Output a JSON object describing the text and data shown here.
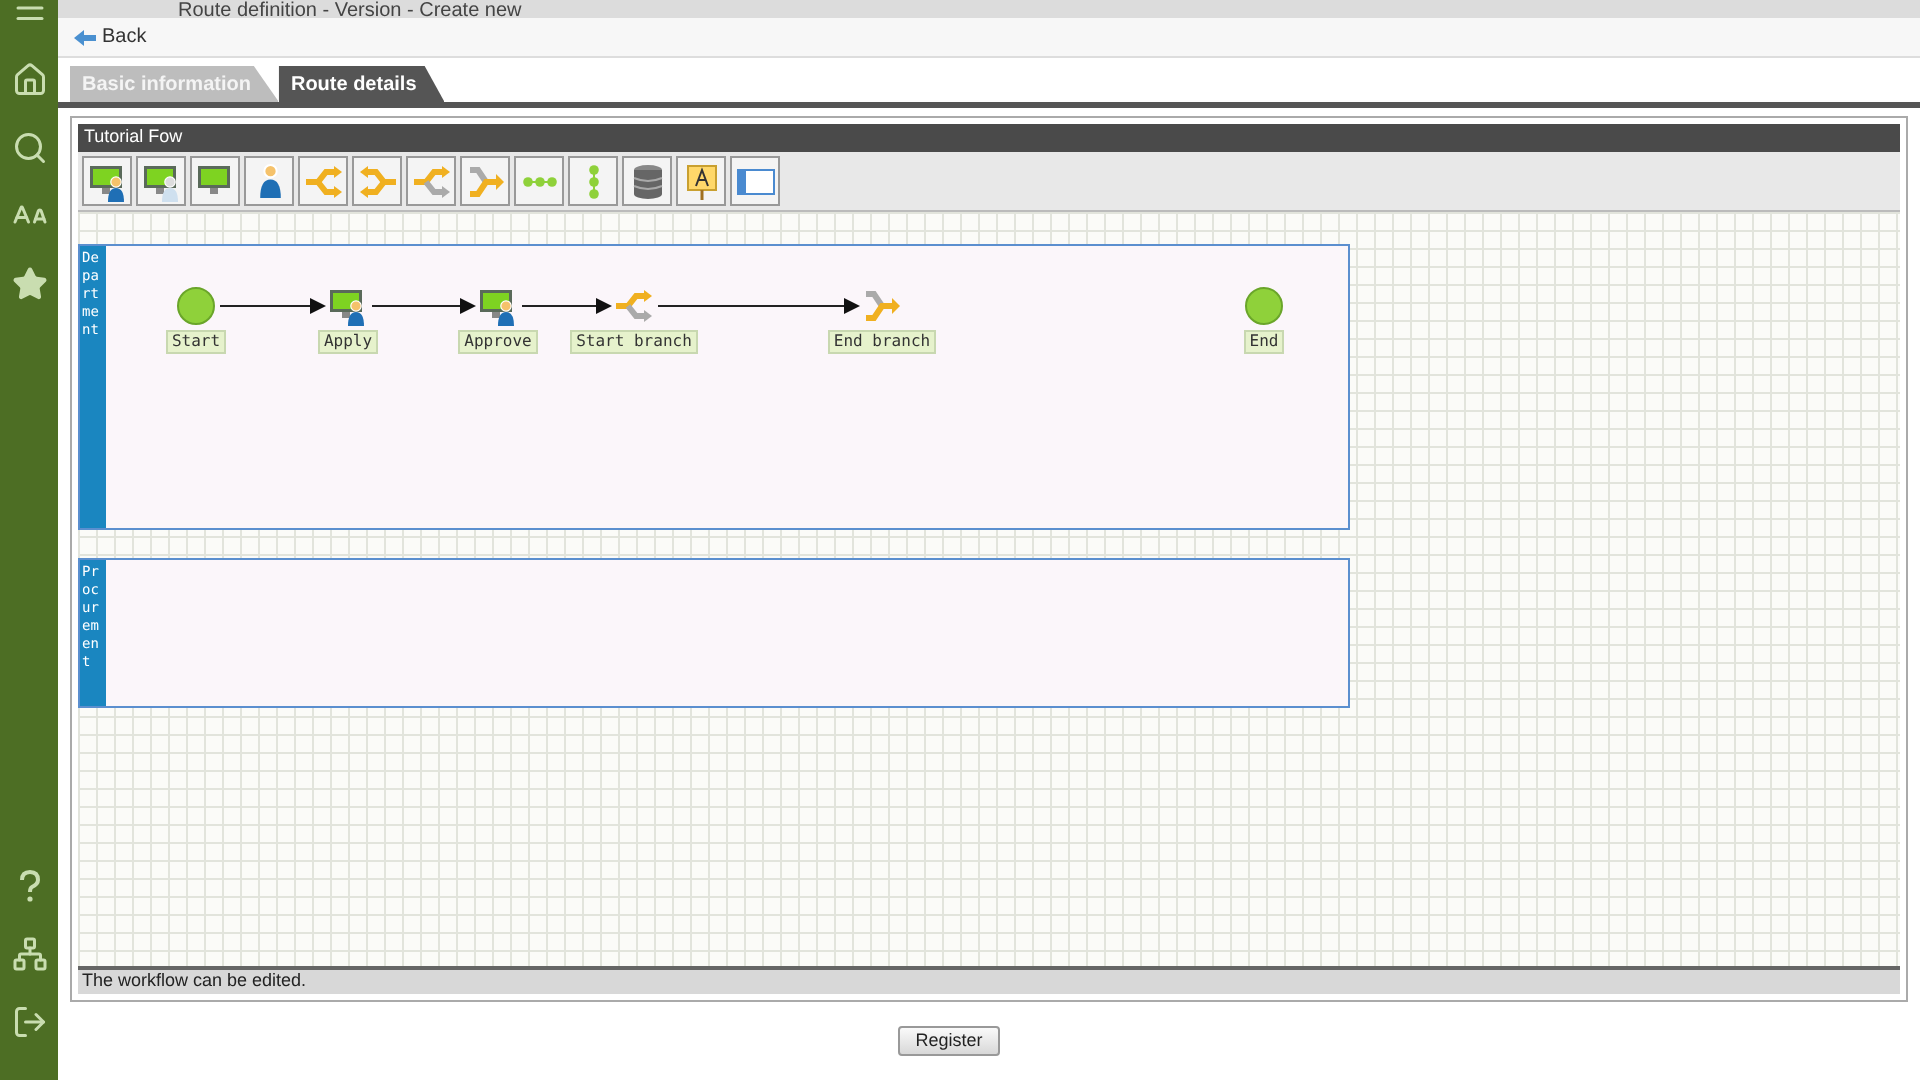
{
  "window": {
    "title": "Route definition - Version - Create new"
  },
  "back": {
    "label": "Back"
  },
  "tabs": [
    {
      "label": "Basic information",
      "selected": false
    },
    {
      "label": "Route details",
      "selected": true
    }
  ],
  "editor": {
    "title": "Tutorial Fow",
    "status": "The workflow can be edited."
  },
  "lanes": [
    {
      "label": "Department",
      "nodes": [
        {
          "kind": "start",
          "label": "Start",
          "arrow_to_next": true
        },
        {
          "kind": "task",
          "label": "Apply",
          "arrow_to_next": true
        },
        {
          "kind": "task",
          "label": "Approve",
          "arrow_to_next": true
        },
        {
          "kind": "split",
          "label": "Start branch",
          "arrow_to_next": true
        },
        {
          "kind": "join",
          "label": "End branch",
          "arrow_to_next": false
        },
        {
          "kind": "end",
          "label": "End"
        }
      ]
    },
    {
      "label": "Procurement"
    }
  ],
  "buttons": [
    {
      "label": "Register"
    }
  ]
}
